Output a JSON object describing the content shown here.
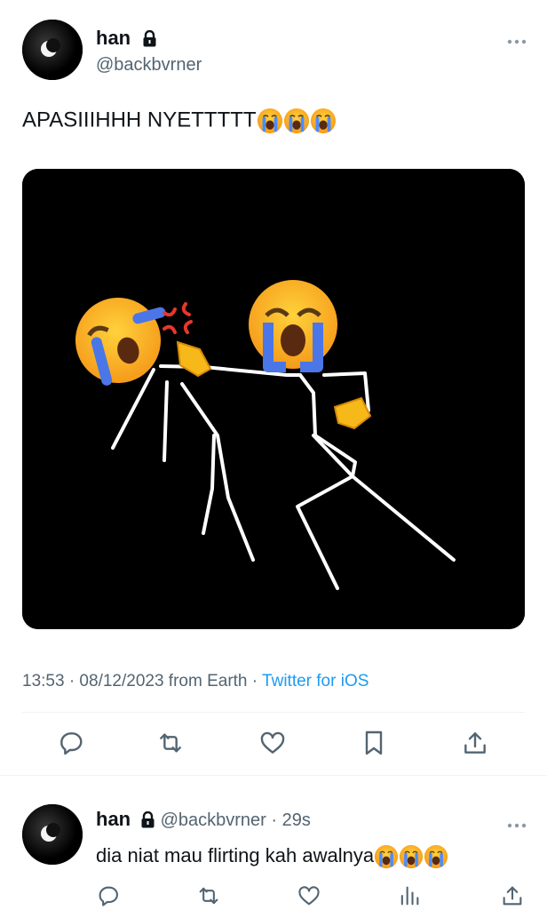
{
  "tweet": {
    "author_name": "han",
    "author_handle": "@backbvrner",
    "text": "APASIIIHHH NYETTTTT",
    "text_emoji": "loudly-crying-face-emoji",
    "text_emoji_count": 3,
    "timestamp": "13:53 · 08/12/2023 from Earth",
    "source": "Twitter for iOS",
    "actions": [
      "reply-icon",
      "retweet-icon",
      "like-icon",
      "bookmark-icon",
      "share-icon"
    ]
  },
  "reply": {
    "author_name": "han",
    "author_handle": "@backbvrner",
    "time": "29s",
    "text": "dia niat mau flirting kah awalnya",
    "text_emoji": "loudly-crying-face-emoji",
    "text_emoji_count": 3,
    "actions": [
      "reply-icon",
      "retweet-icon",
      "like-icon",
      "views-icon",
      "share-icon"
    ]
  },
  "colors": {
    "text": "#0f1419",
    "secondary": "#536471",
    "link": "#1d9bf0",
    "divider": "#eff3f4"
  }
}
